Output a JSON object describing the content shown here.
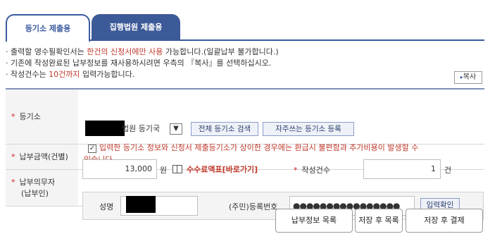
{
  "tabs": [
    {
      "label": "등기소 제출용",
      "active": true
    },
    {
      "label": "집행법원 제출용",
      "active": false
    }
  ],
  "notes": {
    "line1_a": "· 출력할 영수필확인서는 ",
    "line1_red": "한건의 신청서에만 사용",
    "line1_b": " 가능합니다.(일괄납부 불가합니다.)",
    "line2": "· 기존에 작성완료된 납부정보를 재사용하시려면 우측의 『복사』를 선택하십시오.",
    "line3_a": "· 작성건수는 ",
    "line3_red": "10건까지",
    "line3_b": " 입력가능합니다."
  },
  "copy_button": {
    "label": "복사"
  },
  "registry": {
    "label": "등기소",
    "court_suffix": "법원  등기국",
    "select_caret": "▼",
    "search_all_label": "전체 등기소 검색",
    "register_frequent_label": "자주쓰는 등기소 등록",
    "checkbox_checked": true,
    "warning_line1": "입력한 등기소 정보와 신청서 제출등기소가 상이한 경우에는 환급시 불편함과 추가비용이 발생할 수",
    "warning_line2": "있습니다."
  },
  "payment": {
    "label": "납부금액(건별)",
    "amount": "13,000",
    "unit": "원",
    "fee_link": "수수료액표[바로가기]",
    "count_label": "작성건수",
    "count_value": "1",
    "count_unit": "건"
  },
  "payer": {
    "label_line1": "납부의무자",
    "label_line2": "(납부인)",
    "name_label": "성명",
    "id_label": "(주민)등록번호",
    "id_value": "●●●●●●●●●●●●●●●●",
    "confirm_label": "입력확인"
  },
  "bottom_buttons": {
    "list": "납부정보 목록",
    "save_list": "저장 후 목록",
    "save_pay": "저장 후 결제"
  },
  "colors": {
    "accent": "#3b5aa0",
    "warning": "#c0392b"
  }
}
